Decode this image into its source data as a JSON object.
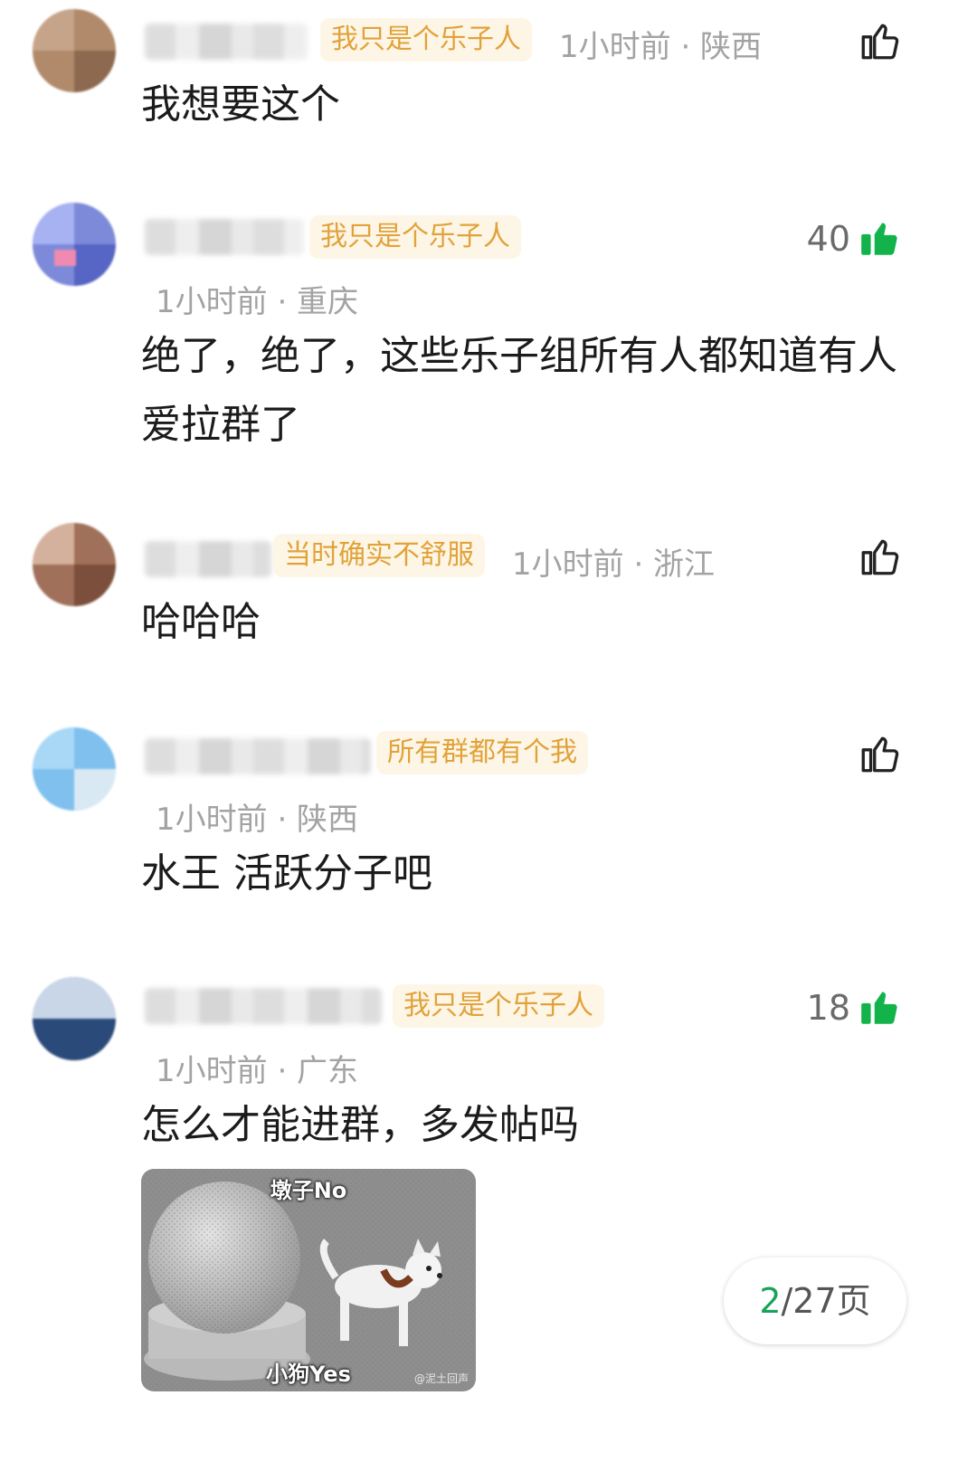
{
  "comments": [
    {
      "badge": "我只是个乐子人",
      "meta": "1小时前 · 陕西",
      "text": "我想要这个",
      "liked": false,
      "like_count": ""
    },
    {
      "badge": "我只是个乐子人",
      "meta": "1小时前 · 重庆",
      "text": "绝了，绝了，这些乐子组所有人都知道有人爱拉群了",
      "liked": true,
      "like_count": "40"
    },
    {
      "badge": "当时确实不舒服",
      "meta": "1小时前 · 浙江",
      "text": "哈哈哈",
      "liked": false,
      "like_count": ""
    },
    {
      "badge": "所有群都有个我",
      "meta": "1小时前 · 陕西",
      "text": "水王 活跃分子吧",
      "liked": false,
      "like_count": ""
    },
    {
      "badge": "我只是个乐子人",
      "meta": "1小时前 · 广东",
      "text": "怎么才能进群，多发帖吗",
      "liked": true,
      "like_count": "18"
    }
  ],
  "meme": {
    "caption_top": "墩子No",
    "caption_bottom": "小狗Yes",
    "watermark": "@泥土回声"
  },
  "pager": {
    "current": "2",
    "total_suffix": "/27页"
  },
  "colors": {
    "badge_text": "#e2a23a",
    "badge_bg": "#fdf6e6",
    "like_active": "#12b34a",
    "meta": "#a3a3a3"
  },
  "icons": {
    "like_outline": "thumbs-up-outline-icon",
    "like_filled": "thumbs-up-filled-icon"
  }
}
